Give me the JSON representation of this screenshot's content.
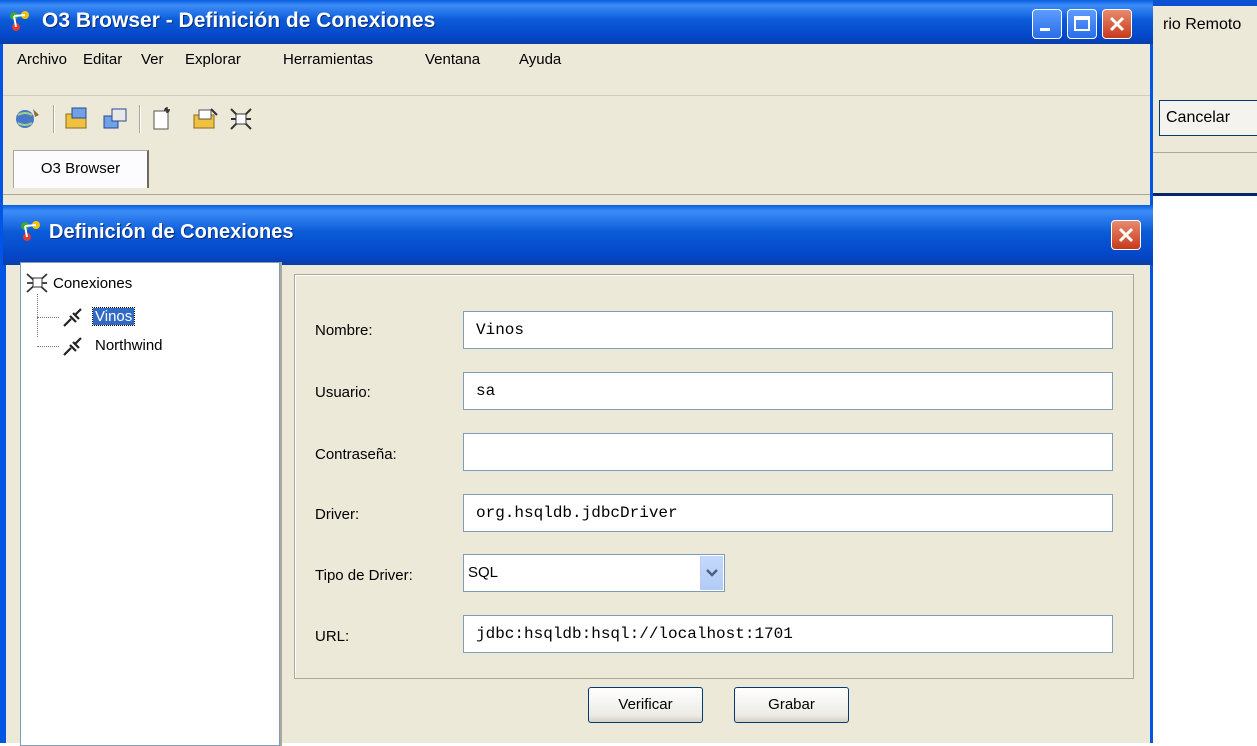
{
  "background_window": {
    "partial_label": "rio Remoto",
    "cancel_label": "Cancelar"
  },
  "window": {
    "title": "O3 Browser - Definición de Conexiones",
    "controls": [
      "minimize-icon",
      "maximize-icon",
      "close-icon"
    ]
  },
  "menu": [
    "Archivo",
    "Editar",
    "Ver",
    "Explorar",
    "Herramientas",
    "Ventana",
    "Ayuda"
  ],
  "toolbar": {
    "icons": [
      "globe-connect-icon",
      "folder-open-icon",
      "folder-close-icon",
      "new-document-icon",
      "edit-folder-icon",
      "connections-icon"
    ]
  },
  "tabs": [
    {
      "label": "O3 Browser"
    }
  ],
  "dialog": {
    "title": "Definición de Conexiones",
    "tree": {
      "root": "Conexiones",
      "items": [
        {
          "label": "Vinos",
          "selected": true
        },
        {
          "label": "Northwind",
          "selected": false
        }
      ]
    },
    "form": {
      "nombre": {
        "label": "Nombre:",
        "value": "Vinos"
      },
      "usuario": {
        "label": "Usuario:",
        "value": "sa"
      },
      "contrasena": {
        "label": "Contraseña:",
        "value": ""
      },
      "driver": {
        "label": "Driver:",
        "value": "org.hsqldb.jdbcDriver"
      },
      "tipo_driver": {
        "label": "Tipo de Driver:",
        "value": "SQL"
      },
      "url": {
        "label": "URL:",
        "value": "jdbc:hsqldb:hsql://localhost:1701"
      }
    },
    "buttons": {
      "verificar": "Verificar",
      "grabar": "Grabar"
    }
  },
  "colors": {
    "title_blue": "#0055e5",
    "selection": "#316ac5",
    "window_bg": "#ece9d8"
  }
}
